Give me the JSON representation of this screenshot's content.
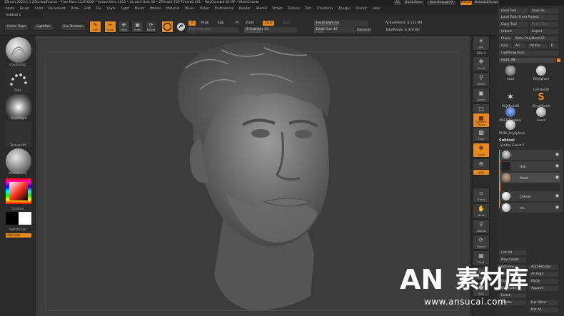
{
  "titlebar": {
    "title": "ZBrush 2020.1.1   ZStartupProject   • Free Mem 15.976GB • Active Mem 1810 • Scratch Disk 48 • ZTime▸2.759 Timer▸0.001 • PolyCount▸4.65 MP • MeshCount▸",
    "ac": "AC",
    "quicksave": "QuickSave",
    "see_through": "See-through   0",
    "menus_label": "Menus",
    "default_script": "DefaultZScript"
  },
  "menubar": {
    "items": [
      "Alpha",
      "Brush",
      "Color",
      "Document",
      "Draw",
      "Edit",
      "File",
      "Layer",
      "Light",
      "Macro",
      "Marker",
      "Material",
      "Movie",
      "Picker",
      "Preferences",
      "Render",
      "Stencil",
      "Stroke",
      "Texture",
      "Tool",
      "Transform",
      "Zplugin",
      "Zscript",
      "Help"
    ]
  },
  "subtool_tag": "Subtool 1",
  "toolbar": {
    "home_page": "Home Page",
    "lightbox": "LightBox",
    "live_boolean": "Live Boolean",
    "edit": "Edit",
    "draw": "Draw",
    "move": "Move",
    "scale": "Scale",
    "rotate": "Rotate",
    "a_label": "A",
    "mrgb": "Mrgb",
    "rgb": "Rgb",
    "m": "M",
    "zadd": "Zadd",
    "zsub": "Zsub",
    "zcut": "Zcut",
    "rgb_intensity": "Rgb Intensity",
    "z_intensity": "Z Intensity 33",
    "focal_shift": "Focal Shift -14",
    "draw_size": "Draw Size 46",
    "dynamic": "Dynamic",
    "active_points": "ActivePoints: 4.131 Mil",
    "total_points": "TotalPoints: 4.378 Mil"
  },
  "leftshelf": {
    "brush": "ClayBuildup",
    "stroke": "Dots",
    "alpha": "~BrushAlpha",
    "texture": "Texture Off",
    "material": "MatCap Gray",
    "gradient": "Gradient",
    "switch_color": "SwitchColor",
    "alternate": "Alternate"
  },
  "iconstrip": {
    "items": [
      "BPR",
      "SPix 3",
      "Scroll",
      "Zoom",
      "Actual",
      "AAHalf",
      "Dynamic Persp",
      "Floor",
      "Local",
      "Gizmo",
      "Frame",
      "Move",
      "ZoomD",
      "Rotate",
      "PolyF",
      "Transp",
      "Solo"
    ]
  },
  "rightpanel": {
    "load_tool": "Load Tool",
    "save_as": "Save As",
    "load_from_project": "Load Tools From Project",
    "copy_tool": "Copy Tool",
    "paste_tool": "Paste Tool",
    "import": "Import",
    "export": "Export",
    "clone": "Clone",
    "make_polymesh": "Make PolyMesh3D",
    "goz": "GoZ",
    "all": "All",
    "visible": "Visible",
    "r": "R",
    "lightbox_tools": "Lightbox▸Tools",
    "head_slider": "head_48",
    "tools": [
      "head",
      "PolySphere",
      "Cylinder3D",
      "PolyMesh3D",
      "SimpleBrush",
      "MRGBZGrabber",
      "Sword",
      "PM3D_PolySphere"
    ],
    "subtool_title": "Subtool",
    "visible_count": "Visible Count 7",
    "subtools": [
      "",
      "Hair",
      "Head",
      "Cornea",
      "Iris"
    ],
    "list_all": "List All",
    "new_folder": "New Folder",
    "rename": "Rename",
    "autoreorder": "AutoReorder",
    "all_low": "All Low",
    "all_high": "All High",
    "copy": "Copy",
    "paste": "Paste",
    "duplicate": "Duplicate",
    "append": "Append",
    "insert": "Insert",
    "delete": "Delete",
    "del_other": "Del Other",
    "del_all": "Del All"
  },
  "watermark": {
    "brand": "AN",
    "chinese": "素材库",
    "url": "www.ansucai.com"
  },
  "colors": {
    "accent": "#e58a1f",
    "canvas": "#3c3c3c",
    "panel": "#2e2e2e"
  }
}
